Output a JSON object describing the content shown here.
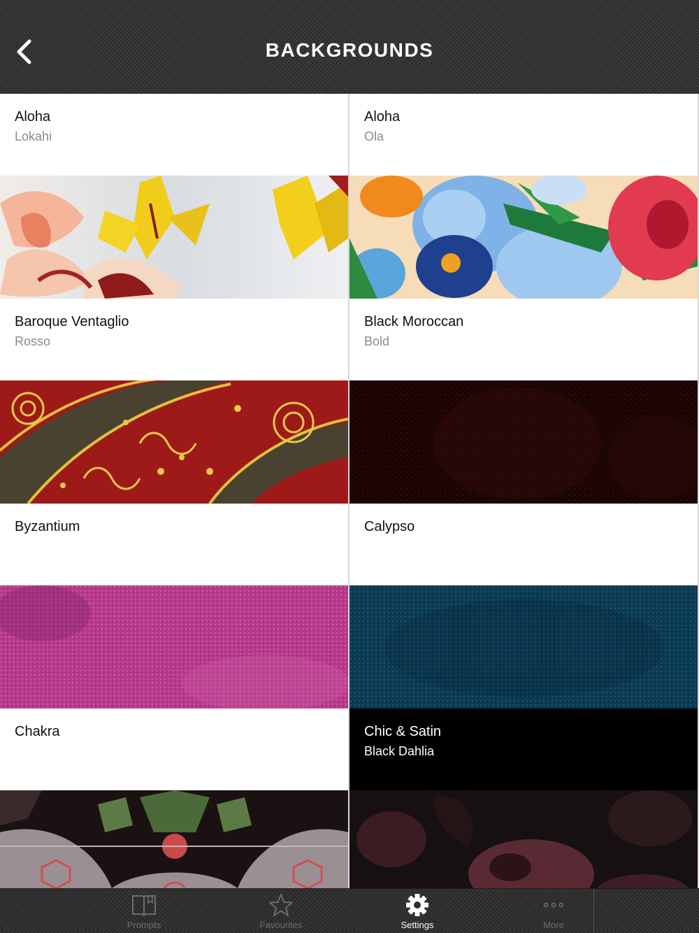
{
  "header": {
    "title": "BACKGROUNDS",
    "back_icon": "chevron-left-icon"
  },
  "backgrounds": [
    {
      "name": "Aloha",
      "subtitle": "Lokahi",
      "pattern": "floral-yellow"
    },
    {
      "name": "Aloha",
      "subtitle": "Ola",
      "pattern": "floral-tropical"
    },
    {
      "name": "Baroque Ventaglio",
      "subtitle": "Rosso",
      "pattern": "baroque-red-gold"
    },
    {
      "name": "Black Moroccan",
      "subtitle": "Bold",
      "pattern": "dark-red-texture"
    },
    {
      "name": "Byzantium",
      "subtitle": "",
      "pattern": "magenta-texture"
    },
    {
      "name": "Calypso",
      "subtitle": "",
      "pattern": "teal-texture"
    },
    {
      "name": "Chakra",
      "subtitle": "",
      "pattern": "tapestry-multicolor"
    },
    {
      "name": "Chic & Satin",
      "subtitle": "Black Dahlia",
      "pattern": "black-dahlia",
      "selected": true
    }
  ],
  "tabbar": {
    "tabs": [
      {
        "label": "Prompts",
        "icon": "book-icon",
        "active": false
      },
      {
        "label": "Favourites",
        "icon": "star-icon",
        "active": false
      },
      {
        "label": "Settings",
        "icon": "gear-icon",
        "active": true
      },
      {
        "label": "More",
        "icon": "ellipsis-icon",
        "active": false
      }
    ]
  },
  "colors": {
    "header_bg": "#333333",
    "selected_cell_bg": "#000000",
    "active_tab_text": "#ffffff",
    "inactive_tab_text": "#6d6d6d"
  }
}
